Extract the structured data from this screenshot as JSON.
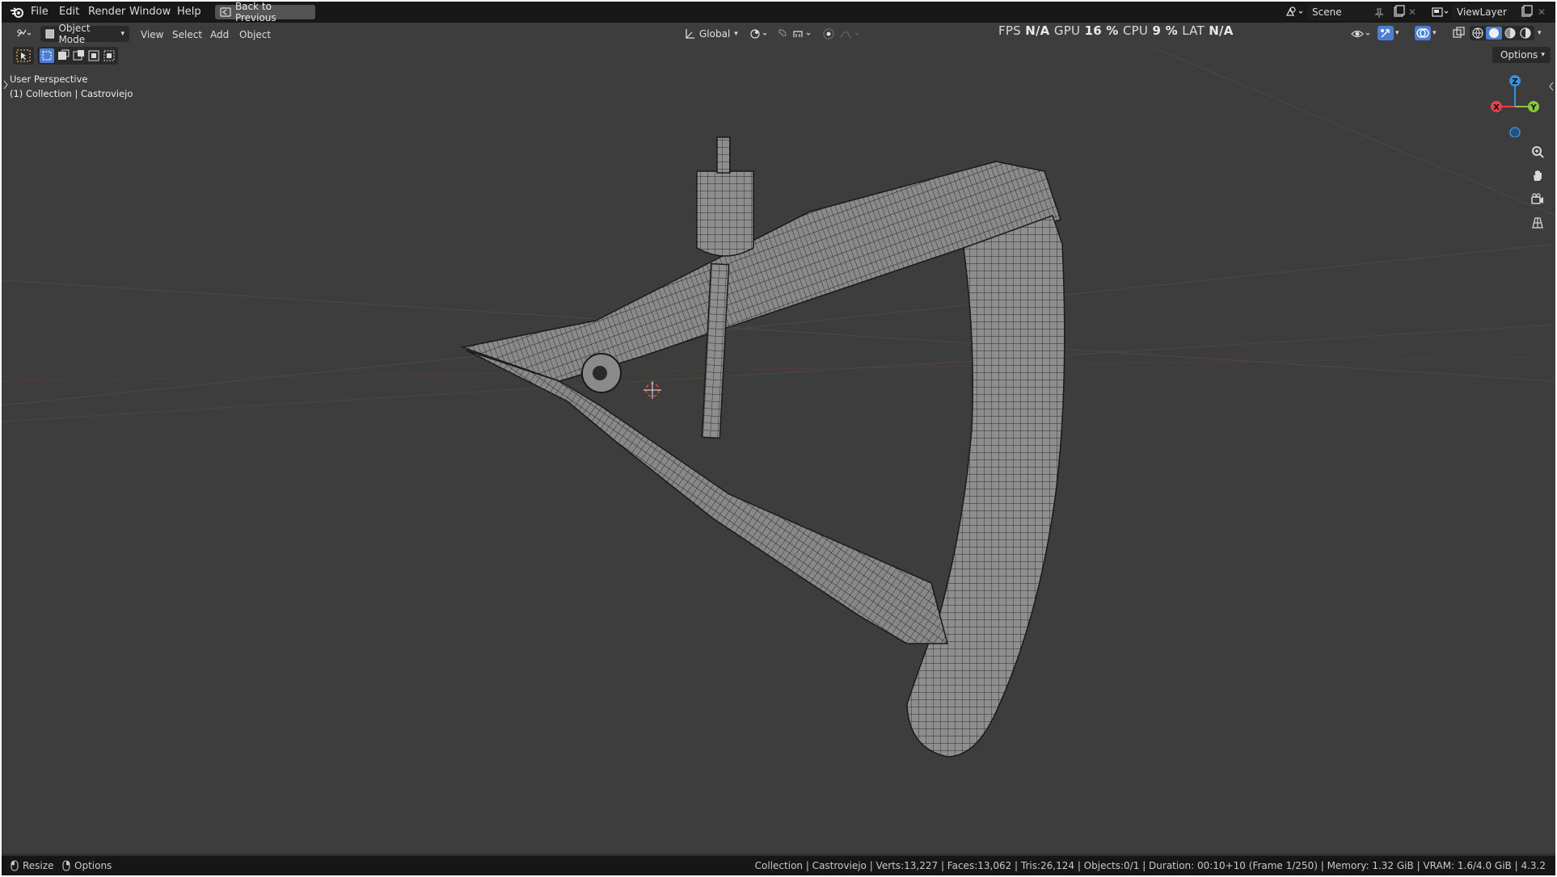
{
  "menu": {
    "file": "File",
    "edit": "Edit",
    "render": "Render",
    "window": "Window",
    "help": "Help",
    "back_to_previous": "Back to Previous"
  },
  "header": {
    "mode": "Object Mode",
    "view": "View",
    "select": "Select",
    "add": "Add",
    "object": "Object",
    "orientation": "Global",
    "options": "Options"
  },
  "stats": {
    "fps_label": "FPS",
    "fps_value": "N/A",
    "gpu_label": "GPU",
    "gpu_value": "16 %",
    "cpu_label": "CPU",
    "cpu_value": "9 %",
    "lat_label": "LAT",
    "lat_value": "N/A"
  },
  "scene": {
    "name": "Scene",
    "view_layer": "ViewLayer"
  },
  "viewport": {
    "perspective": "User Perspective",
    "collection_info": "(1) Collection | Castroviejo"
  },
  "gizmo": {
    "x": "X",
    "y": "Y",
    "z": "Z"
  },
  "statusbar": {
    "resize": "Resize",
    "options": "Options",
    "info": "Collection | Castroviejo | Verts:13,227 | Faces:13,062 | Tris:26,124 | Objects:0/1 | Duration: 00:10+10 (Frame 1/250) | Memory: 1.32 GiB | VRAM: 1.6/4.0 GiB | 4.3.2"
  },
  "colors": {
    "axis_x": "#e8404f",
    "axis_y": "#8bc53f",
    "axis_z": "#3b8fd9",
    "accent": "#4a7fd4"
  },
  "icons": [
    "blender-logo-icon",
    "back-icon",
    "editor-type-icon",
    "object-mode-icon",
    "transform-orientation-icon",
    "pivot-icon",
    "snap-icon",
    "proportional-icon",
    "scene-icon",
    "pin-icon",
    "new-scene-icon",
    "close-icon",
    "viewlayer-icon",
    "visibility-icon",
    "gizmo-icon",
    "overlay-icon",
    "xray-icon",
    "wireframe-shading-icon",
    "solid-shading-icon",
    "material-shading-icon",
    "rendered-shading-icon",
    "select-box-icon",
    "zoom-icon",
    "pan-icon",
    "camera-icon",
    "grid-icon",
    "3d-cursor-icon",
    "mouse-icon"
  ]
}
